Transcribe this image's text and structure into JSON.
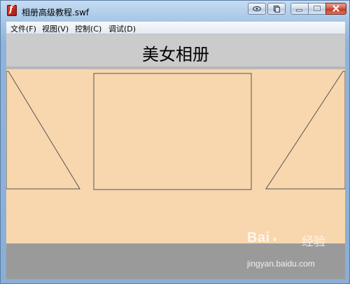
{
  "window": {
    "title": "相册高级教程.swf",
    "icon": "flash-player-icon"
  },
  "titlebar_buttons": [
    "eye-icon",
    "copy-icon",
    "minimize-icon",
    "maximize-icon",
    "close-icon"
  ],
  "menu": {
    "items": [
      {
        "label": "文件(F)"
      },
      {
        "label": "视图(V)"
      },
      {
        "label": "控制(C)"
      },
      {
        "label": "调试(D)"
      }
    ]
  },
  "content": {
    "album_title": "美女相册",
    "colors": {
      "background": "#f8d7ae",
      "header_band": "#cbcbcb",
      "footer_band": "#9a9a9a",
      "outline": "#555555"
    }
  },
  "watermark": {
    "brand_a": "Bai",
    "brand_b": "经验",
    "url": "jingyan.baidu.com"
  }
}
